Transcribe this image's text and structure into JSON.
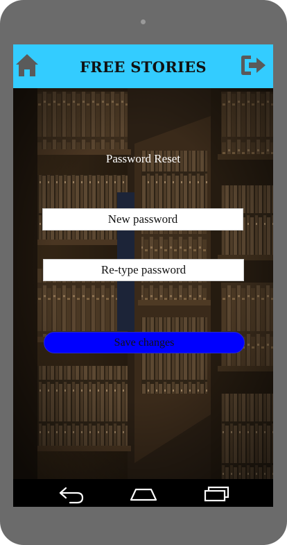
{
  "app": {
    "title": "FREE STORIES",
    "accent_color": "#33ccff"
  },
  "header": {
    "home_icon": "home-icon",
    "logout_icon": "logout-icon"
  },
  "form": {
    "title": "Password Reset",
    "new_password_placeholder": "New password",
    "retype_password_placeholder": "Re-type password",
    "save_label": "Save changes",
    "save_color": "#0000ff"
  },
  "system_nav": {
    "back_icon": "back-icon",
    "home_icon": "nav-home-icon",
    "recents_icon": "recents-icon"
  }
}
